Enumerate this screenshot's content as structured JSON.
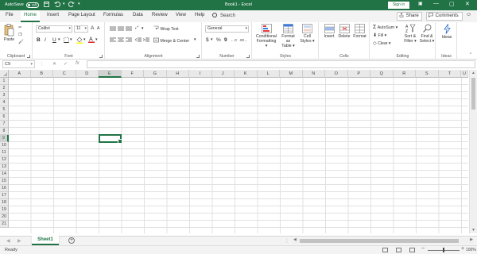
{
  "title_bar": {
    "autosave_label": "AutoSave",
    "autosave_state": "Off",
    "doc_title": "Book1 - Excel",
    "signin_label": "Sign in",
    "minimize": "—",
    "restore": "▢",
    "close": "✕",
    "save_icon": "save-icon",
    "undo_icon": "undo-icon",
    "redo_icon": "redo-icon"
  },
  "tabs": [
    "File",
    "Home",
    "Insert",
    "Page Layout",
    "Formulas",
    "Data",
    "Review",
    "View",
    "Help"
  ],
  "active_tab": "Home",
  "search": {
    "placeholder": "Search"
  },
  "share": {
    "label": "Share"
  },
  "comments": {
    "label": "Comments"
  },
  "ribbon": {
    "clipboard": {
      "label": "Clipboard",
      "paste": "Paste"
    },
    "font": {
      "label": "Font",
      "name": "Calibri",
      "size": "11",
      "bold": "B",
      "italic": "I",
      "underline": "U",
      "grow": "A",
      "shrink": "A"
    },
    "alignment": {
      "label": "Alignment",
      "wrap": "Wrap Text",
      "merge": "Merge & Center"
    },
    "number": {
      "label": "Number",
      "format": "General",
      "currency": "$",
      "percent": "%",
      "comma": "9",
      "inc": "←.0",
      "dec": ".00→"
    },
    "styles": {
      "label": "Styles",
      "conditional": "Conditional",
      "conditional2": "Formatting ▾",
      "format_table": "Format as",
      "format_table2": "Table ▾",
      "cell_styles": "Cell",
      "cell_styles2": "Styles ▾"
    },
    "cells": {
      "label": "Cells",
      "insert": "Insert",
      "delete": "Delete",
      "format": "Format"
    },
    "editing": {
      "label": "Editing",
      "autosum": "AutoSum",
      "fill": "Fill",
      "clear": "Clear",
      "sort": "Sort &",
      "sort2": "Filter ▾",
      "find": "Find &",
      "find2": "Select ▾"
    },
    "ideas": {
      "label": "Ideas",
      "button": "Ideas"
    }
  },
  "formula_bar": {
    "name_box": "C9",
    "cancel": "✕",
    "enter": "✓",
    "fx": "fx",
    "value": ""
  },
  "columns": [
    "A",
    "B",
    "C",
    "D",
    "E",
    "F",
    "G",
    "H",
    "I",
    "J",
    "K",
    "L",
    "M",
    "N",
    "O",
    "P",
    "Q",
    "R",
    "S",
    "T",
    "U"
  ],
  "rows": [
    "1",
    "2",
    "3",
    "4",
    "5",
    "6",
    "7",
    "8",
    "9",
    "10",
    "11",
    "12",
    "13",
    "14",
    "15",
    "16",
    "17",
    "18",
    "19",
    "20",
    "21"
  ],
  "active_cell": {
    "column": "E",
    "row": "9"
  },
  "sheet_tabs": [
    {
      "name": "Sheet1",
      "active": true
    }
  ],
  "status": {
    "text": "Ready",
    "zoom": "100%"
  },
  "colors": {
    "accent": "#217346",
    "grid": "#e1e1e1",
    "header_bg": "#e9e9e9"
  }
}
